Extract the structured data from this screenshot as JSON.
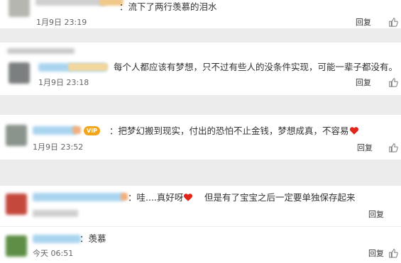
{
  "comments": [
    {
      "text": "：流下了两行羡慕的泪水",
      "time": "1月9日 23:19",
      "reply": "回复",
      "avatar_color": "#b6b6b0"
    },
    {
      "text": "每个人都应该有梦想，只不过有些人的没条件实现，可能一辈子都没有。",
      "time": "1月9日 23:18",
      "reply": "回复",
      "avatar_color": "#7b7f80"
    },
    {
      "text": "：把梦幻搬到现实，付出的恐怕不止金钱，梦想成真，不容易",
      "badge": "VIP",
      "time": "1月9日 23:52",
      "reply": "回复",
      "avatar_color": "#8a948c"
    },
    {
      "text": "：哇....真好呀",
      "text2": "但是有了宝宝之后一定要单独保存起来",
      "time": "",
      "reply": "回复",
      "avatar_color": "#c4483c"
    },
    {
      "text": "：羡慕",
      "time": "今天 06:51",
      "reply": "回复",
      "avatar_color": "#5f8f46"
    }
  ],
  "colors": {
    "background": "#ececec",
    "card": "#ffffff",
    "username_blue": "#a9d4ef",
    "heart": "#e1251b",
    "vip": "#f3a51c"
  },
  "icons": [
    "thumbs-up-icon",
    "heart-icon"
  ]
}
